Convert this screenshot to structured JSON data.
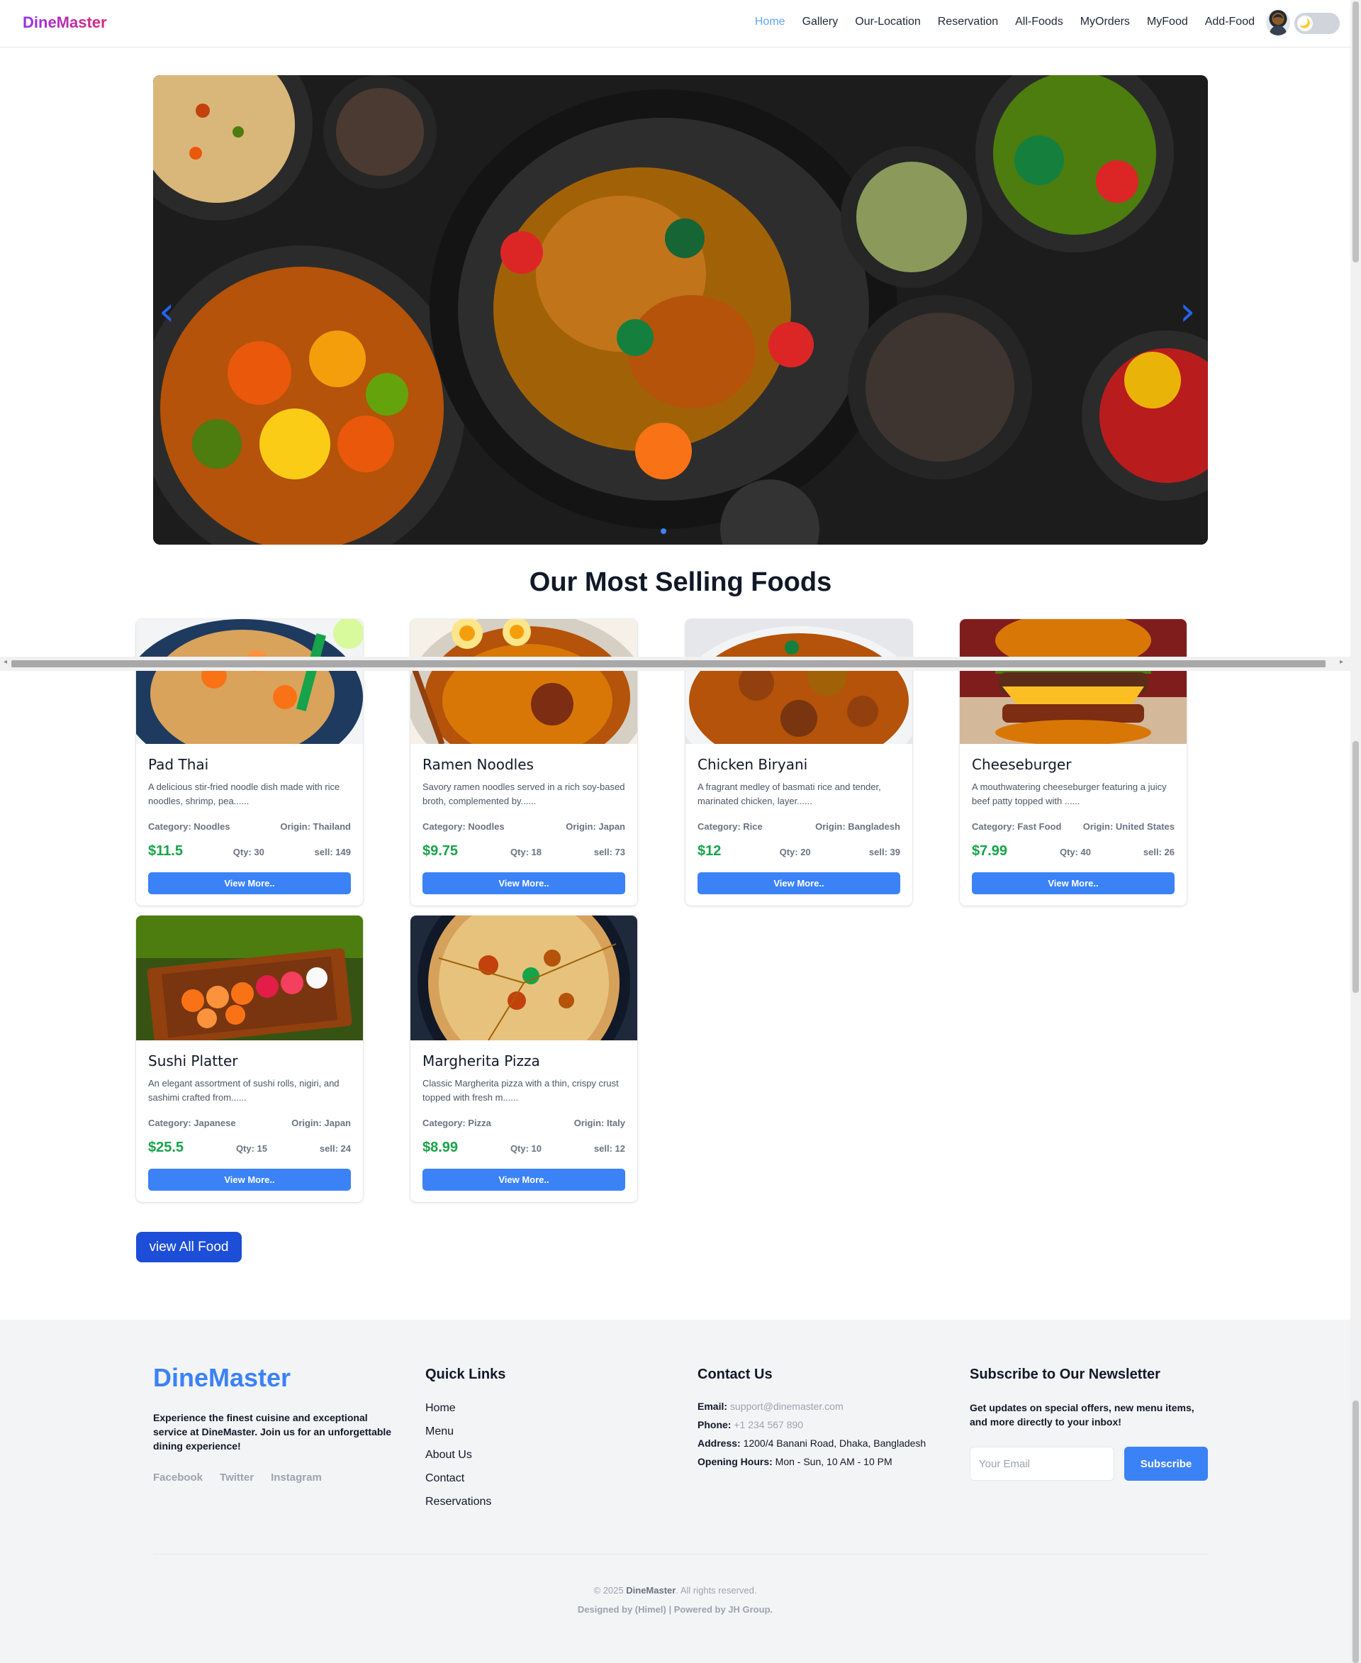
{
  "nav": {
    "brand": "DineMaster",
    "links": [
      "Home",
      "Gallery",
      "Our-Location",
      "Reservation",
      "All-Foods",
      "MyOrders",
      "MyFood",
      "Add-Food"
    ],
    "active": "Home",
    "theme_toggle_icon": "🌙"
  },
  "hero": {
    "prev_arrow": "‹",
    "next_arrow": "›",
    "slide_count": 1,
    "active_slide": 1
  },
  "section": {
    "title": "Our Most Selling Foods"
  },
  "foods": [
    {
      "name": "Pad Thai",
      "description": "A delicious stir-fried noodle dish made with rice noodles, shrimp, pea......",
      "category": "Category: Noodles",
      "origin": "Origin: Thailand",
      "price": "$11.5",
      "qty": "Qty: 30",
      "sell": "sell: 149",
      "button": "View More..",
      "image": "pad-thai-photo"
    },
    {
      "name": "Ramen Noodles",
      "description": "Savory ramen noodles served in a rich soy-based broth, complemented by......",
      "category": "Category: Noodles",
      "origin": "Origin: Japan",
      "price": "$9.75",
      "qty": "Qty: 18",
      "sell": "sell: 73",
      "button": "View More..",
      "image": "ramen-photo"
    },
    {
      "name": "Chicken Biryani",
      "description": "A fragrant medley of basmati rice and tender, marinated chicken, layer......",
      "category": "Category: Rice",
      "origin": "Origin: Bangladesh",
      "price": "$12",
      "qty": "Qty: 20",
      "sell": "sell: 39",
      "button": "View More..",
      "image": "biryani-photo"
    },
    {
      "name": "Cheeseburger",
      "description": "A mouthwatering cheeseburger featuring a juicy beef patty topped with ......",
      "category": "Category: Fast Food",
      "origin": "Origin: United States",
      "price": "$7.99",
      "qty": "Qty: 40",
      "sell": "sell: 26",
      "button": "View More..",
      "image": "burger-photo"
    },
    {
      "name": "Sushi Platter",
      "description": "An elegant assortment of sushi rolls, nigiri, and sashimi crafted from......",
      "category": "Category: Japanese",
      "origin": "Origin: Japan",
      "price": "$25.5",
      "qty": "Qty: 15",
      "sell": "sell: 24",
      "button": "View More..",
      "image": "sushi-photo"
    },
    {
      "name": "Margherita Pizza",
      "description": "Classic Margherita pizza with a thin, crispy crust topped with fresh m......",
      "category": "Category: Pizza",
      "origin": "Origin: Italy",
      "price": "$8.99",
      "qty": "Qty: 10",
      "sell": "sell: 12",
      "button": "View More..",
      "image": "pizza-photo"
    }
  ],
  "view_all_label": "view All Food",
  "footer": {
    "brand": "DineMaster",
    "about": "Experience the finest cuisine and exceptional service at DineMaster. Join us for an unforgettable dining experience!",
    "social": [
      "Facebook",
      "Twitter",
      "Instagram"
    ],
    "quick_links_title": "Quick Links",
    "quick_links": [
      "Home",
      "Menu",
      "About Us",
      "Contact",
      "Reservations"
    ],
    "contact_title": "Contact Us",
    "contact": {
      "email_label": "Email:",
      "email": "support@dinemaster.com",
      "phone_label": "Phone:",
      "phone": "+1 234 567 890",
      "address_label": "Address:",
      "address": "1200/4 Banani Road, Dhaka, Bangladesh",
      "hours_label": "Opening Hours:",
      "hours": "Mon - Sun, 10 AM - 10 PM"
    },
    "newsletter_title": "Subscribe to Our Newsletter",
    "newsletter_text": "Get updates on special offers, new menu items, and more directly to your inbox!",
    "email_placeholder": "Your Email",
    "subscribe_label": "Subscribe",
    "copyright_prefix": "© 2025",
    "copyright_brand": "DineMaster",
    "copyright_suffix": ". All rights reserved.",
    "credit": "Designed by (Himel) | Powered by JH Group."
  },
  "colors": {
    "accent": "#3b82f6",
    "price": "#16a34a",
    "view_all": "#1d4ed8",
    "footer_bg": "#f3f4f6"
  }
}
